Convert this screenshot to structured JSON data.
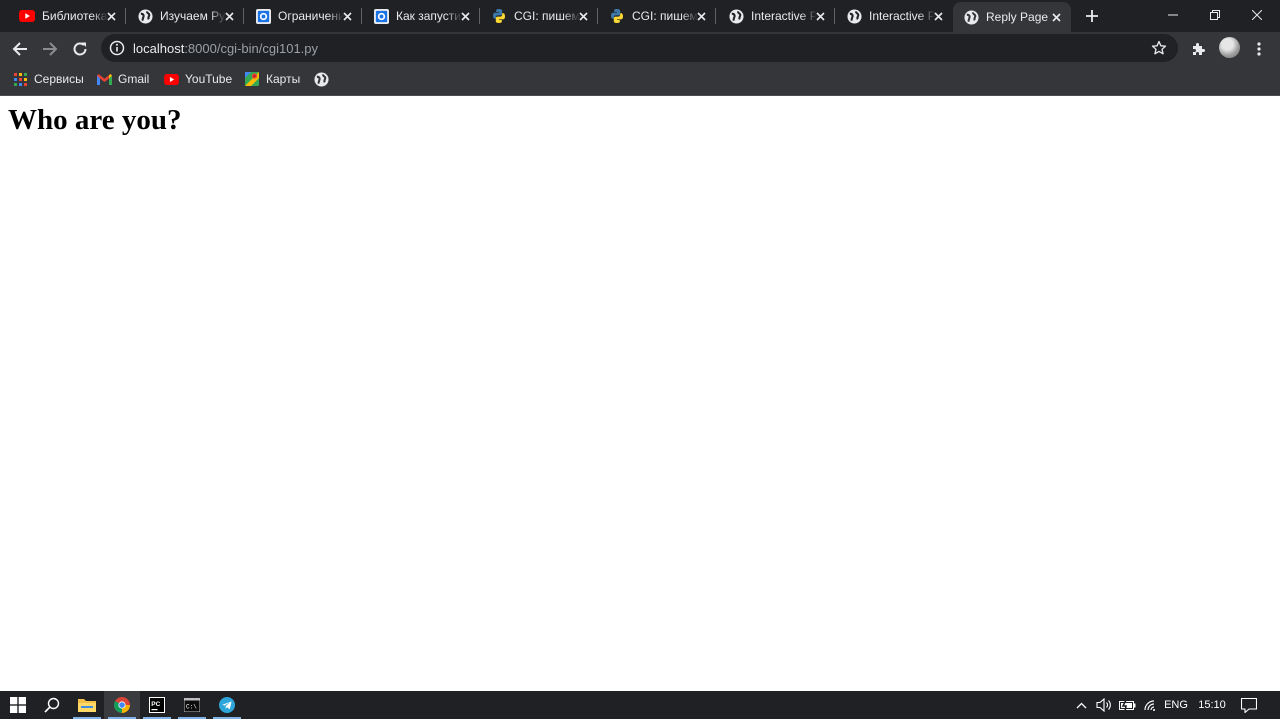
{
  "browser": {
    "tabs": [
      {
        "title": "Библиотека",
        "icon": "youtube-icon"
      },
      {
        "title": "Изучаем Python",
        "icon": "globe-icon"
      },
      {
        "title": "Ограничения",
        "icon": "blue-square-icon"
      },
      {
        "title": "Как запустить",
        "icon": "blue-square-icon"
      },
      {
        "title": "CGI: пишем",
        "icon": "python-icon"
      },
      {
        "title": "CGI: пишем",
        "icon": "python-icon"
      },
      {
        "title": "Interactive P",
        "icon": "globe-icon"
      },
      {
        "title": "Interactive P",
        "icon": "globe-icon"
      },
      {
        "title": "Reply Page",
        "icon": "globe-icon",
        "active": true
      }
    ],
    "address": {
      "host": "localhost",
      "path": ":8000/cgi-bin/cgi101.py"
    },
    "bookmarks": [
      {
        "label": "Сервисы",
        "icon": "apps-grid-icon"
      },
      {
        "label": "Gmail",
        "icon": "gmail-icon"
      },
      {
        "label": "YouTube",
        "icon": "youtube-icon"
      },
      {
        "label": "Карты",
        "icon": "maps-icon"
      },
      {
        "label": "",
        "icon": "globe-icon"
      }
    ]
  },
  "page": {
    "heading": "Who are you?"
  },
  "taskbar": {
    "apps": [
      "start-icon",
      "search-icon",
      "file-explorer-icon",
      "chrome-icon",
      "pycharm-icon",
      "terminal-icon",
      "telegram-icon"
    ],
    "language": "ENG",
    "time": "15:10"
  },
  "colors": {
    "tabstrip_bg": "#202124",
    "toolbar_bg": "#35363a",
    "omnibox_bg": "#202124",
    "taskbar_bg": "#202125"
  }
}
